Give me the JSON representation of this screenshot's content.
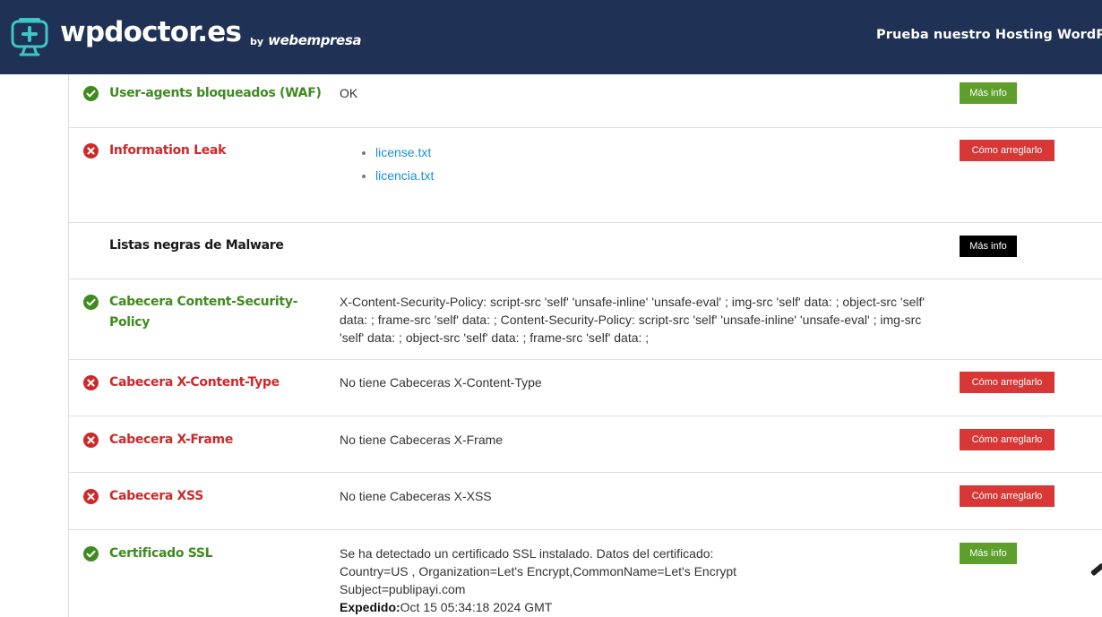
{
  "header": {
    "logo_text": "wpdoctor.es",
    "logo_by": "by",
    "logo_brand": "webempresa",
    "cta": "Prueba nuestro Hosting WordPre"
  },
  "colors": {
    "header_bg": "#1f3154",
    "ok": "#3f8b1f",
    "bad": "#cc2a2a",
    "link": "#1a8fd6"
  },
  "rows": [
    {
      "status": "ok",
      "title": "User-agents bloqueados (WAF)",
      "value": "OK",
      "button": "Más info"
    },
    {
      "status": "bad",
      "title": "Information Leak",
      "links": [
        "license.txt",
        "licencia.txt"
      ],
      "button": "Cómo arreglarlo"
    },
    {
      "status": "none",
      "title": "Listas negras de Malware",
      "button": "Más info"
    },
    {
      "status": "ok",
      "title": "Cabecera Content-Security-Policy",
      "value": "X-Content-Security-Policy: script-src 'self' 'unsafe-inline' 'unsafe-eval' ; img-src 'self' data: ; object-src 'self' data: ; frame-src 'self' data: ; Content-Security-Policy: script-src 'self' 'unsafe-inline' 'unsafe-eval' ; img-src 'self' data: ; object-src 'self' data: ; frame-src 'self' data: ;"
    },
    {
      "status": "bad",
      "title": "Cabecera X-Content-Type",
      "value": "No tiene Cabeceras X-Content-Type",
      "button": "Cómo arreglarlo"
    },
    {
      "status": "bad",
      "title": "Cabecera X-Frame",
      "value": "No tiene Cabeceras X-Frame",
      "button": "Cómo arreglarlo"
    },
    {
      "status": "bad",
      "title": "Cabecera XSS",
      "value": "No tiene Cabeceras X-XSS",
      "button": "Cómo arreglarlo"
    },
    {
      "status": "ok",
      "title": "Certificado SSL",
      "value_lines": [
        "Se ha detectado un certificado SSL instalado. Datos del certificado:",
        "Country=US , Organization=Let's Encrypt,CommonName=Let's Encrypt",
        "Subject=publipayi.com"
      ],
      "issued_label": "Expedido:",
      "issued_value": "Oct 15 05:34:18 2024 GMT",
      "button": "Más info"
    }
  ]
}
